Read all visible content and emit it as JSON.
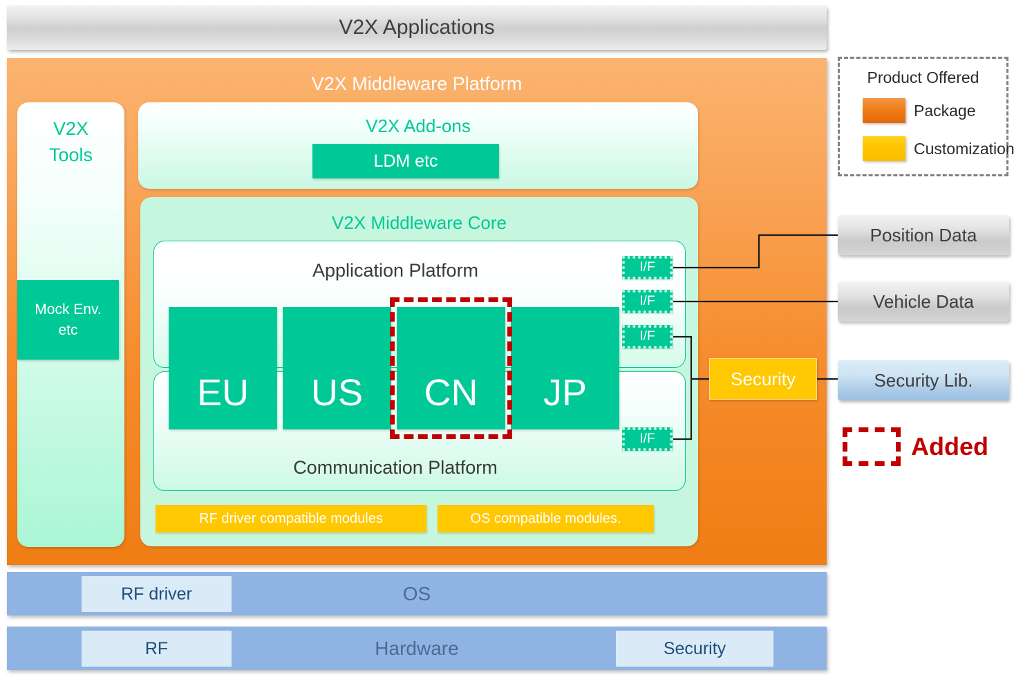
{
  "top_bar": {
    "label": "V2X Applications"
  },
  "middleware": {
    "title": "V2X Middleware Platform",
    "tools": {
      "title_line1": "V2X",
      "title_line2": "Tools",
      "item_line1": "Mock Env.",
      "item_line2": "etc"
    },
    "addons": {
      "title": "V2X Add-ons",
      "item": "LDM etc"
    },
    "core": {
      "title": "V2X Middleware Core",
      "application_platform": "Application Platform",
      "communication_platform": "Communication Platform",
      "regions": [
        "EU",
        "US",
        "CN",
        "JP"
      ],
      "added_region": "CN",
      "interfaces": [
        "I/F",
        "I/F",
        "I/F",
        "I/F"
      ],
      "compatible_modules": [
        "RF driver compatible modules",
        "OS compatible modules."
      ]
    },
    "security": "Security"
  },
  "callouts": [
    {
      "label": "Position Data",
      "style": "gray"
    },
    {
      "label": "Vehicle Data",
      "style": "gray"
    },
    {
      "label": "Security Lib.",
      "style": "blue"
    }
  ],
  "legend": {
    "title": "Product Offered",
    "items": [
      {
        "label": "Package",
        "color": "#EF7D17"
      },
      {
        "label": "Customization",
        "color": "#FFC400"
      }
    ]
  },
  "added_legend": {
    "label": "Added",
    "color": "#C00000"
  },
  "bottom": {
    "os_bar": {
      "main": "OS",
      "chip": "RF driver"
    },
    "hw_bar": {
      "main": "Hardware",
      "chip_left": "RF",
      "chip_right": "Security"
    }
  },
  "colors": {
    "teal": "#00C896",
    "mint": "#C6F7DE",
    "orange_light": "#FBB470",
    "orange_dark": "#F07D14",
    "yellow": "#FFC800",
    "red": "#C00000",
    "blue_bar": "#8FB4E3",
    "blue_chip": "#DBEAF7"
  }
}
